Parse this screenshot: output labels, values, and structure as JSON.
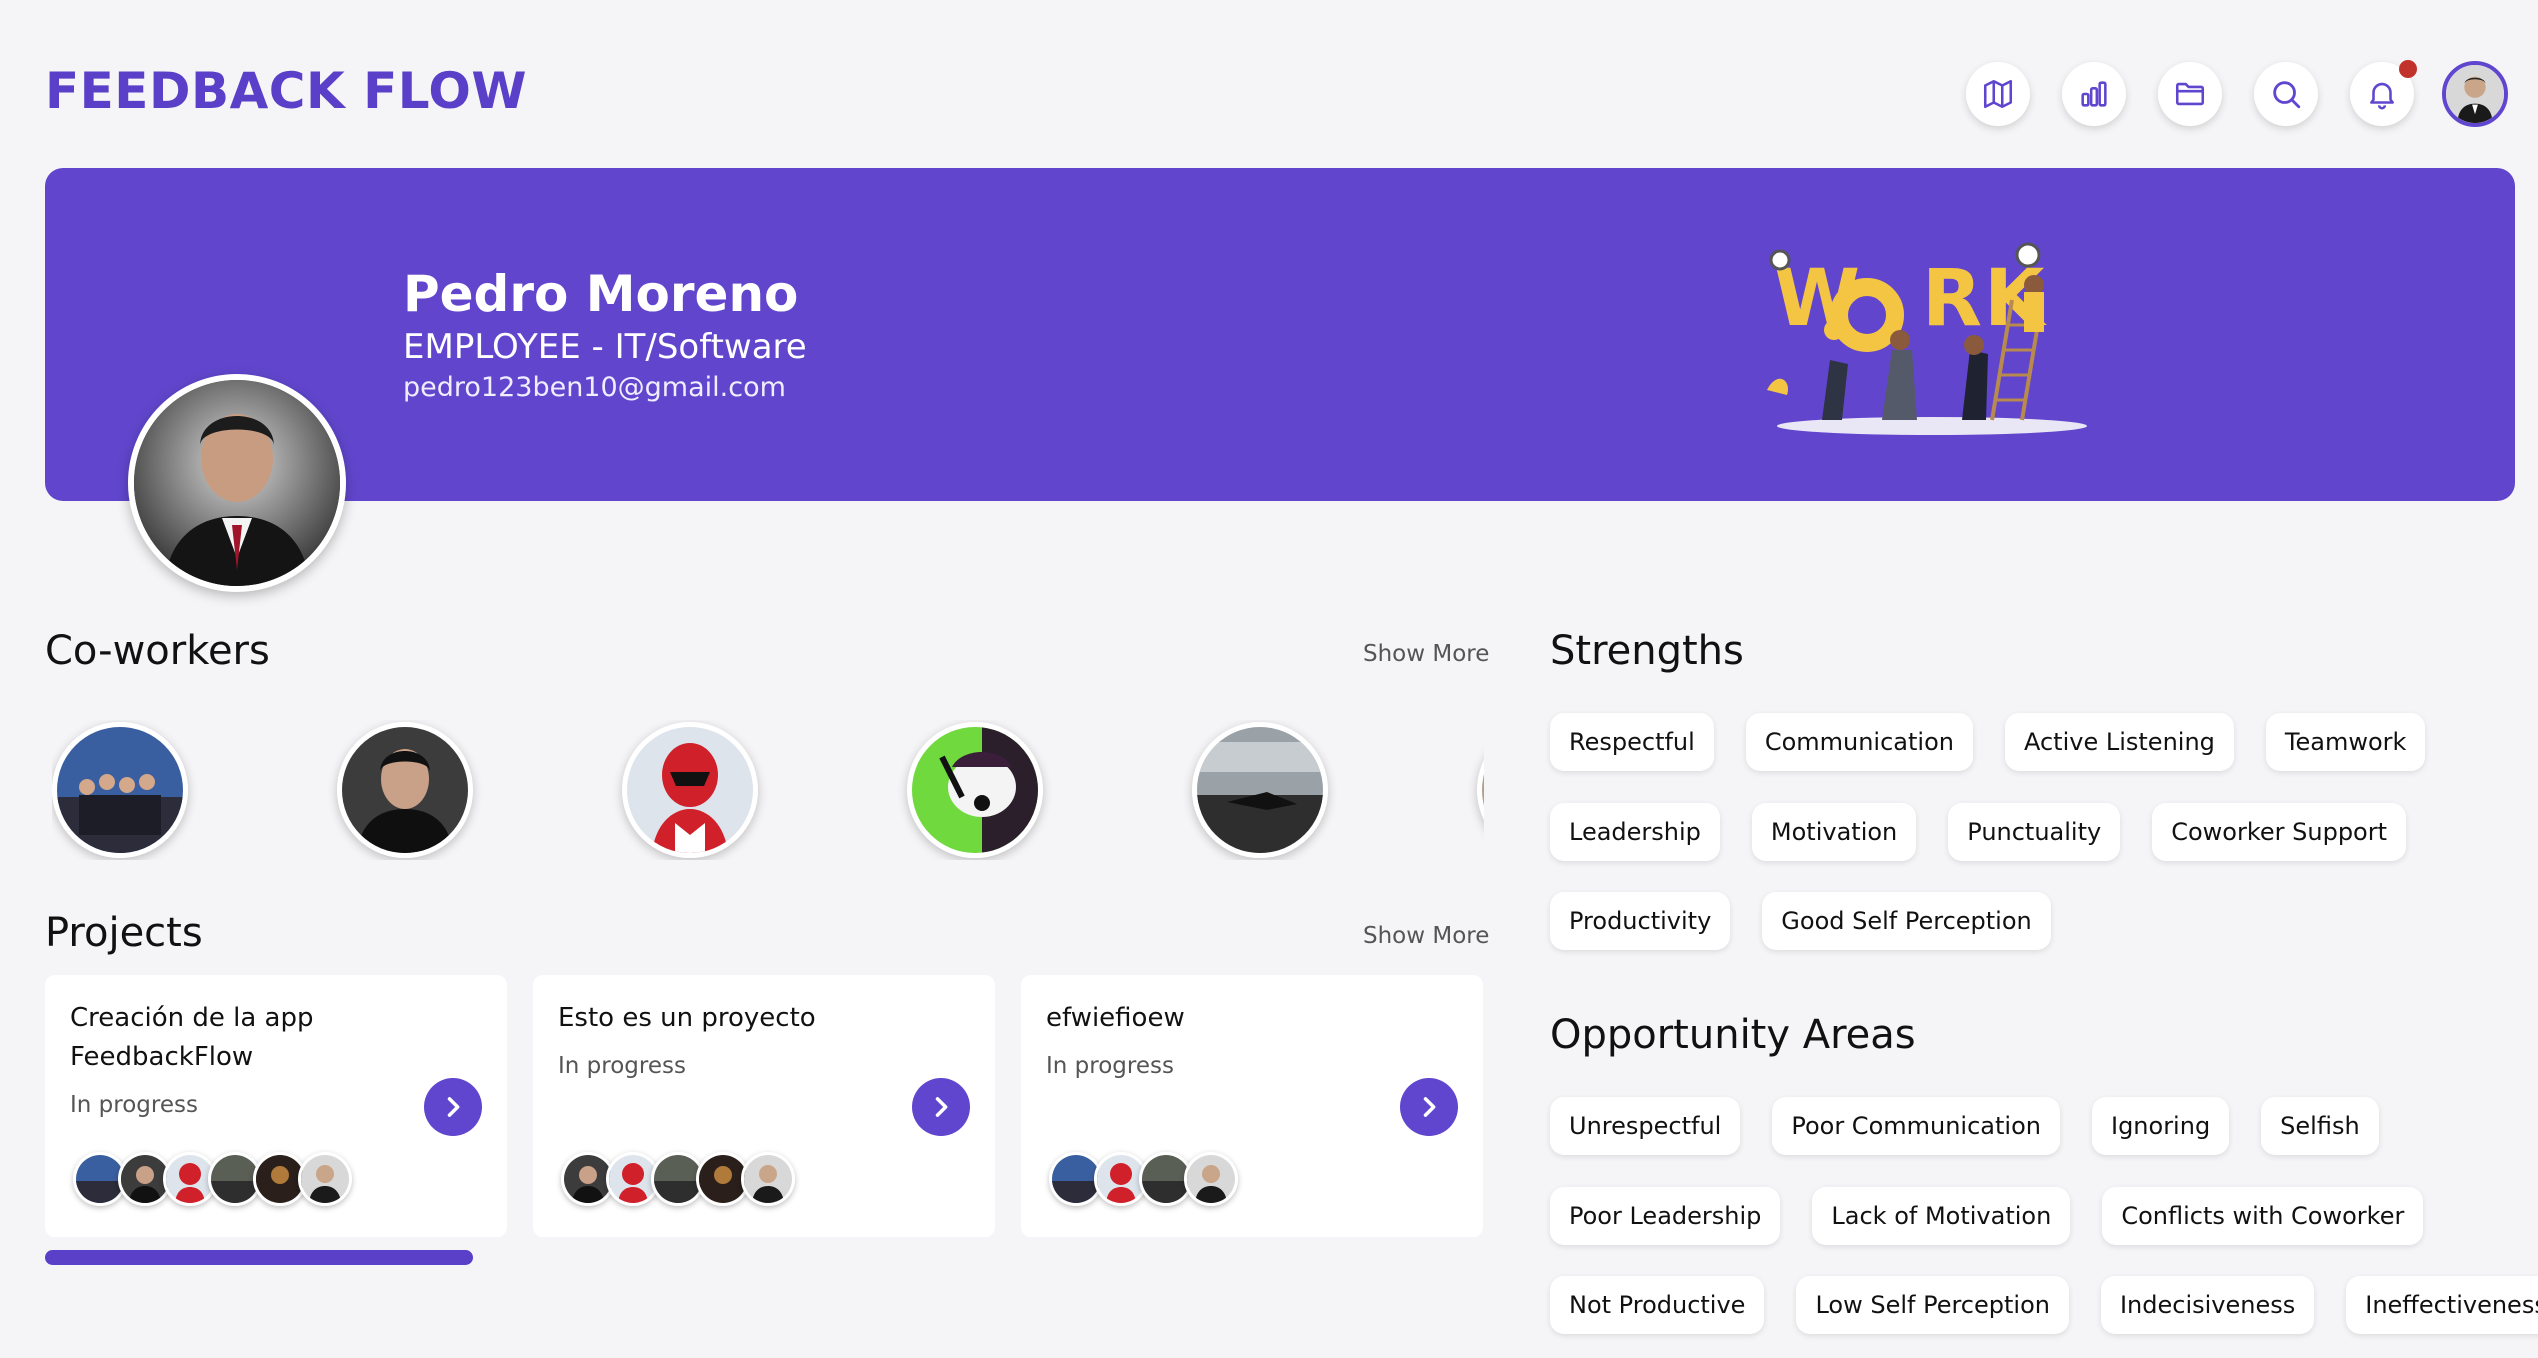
{
  "header": {
    "logo": "FEEDBACK FLOW",
    "icons": [
      "map-icon",
      "bar-chart-icon",
      "folder-icon",
      "search-icon",
      "bell-icon"
    ],
    "has_notification": true
  },
  "profile": {
    "name": "Pedro Moreno",
    "role": "EMPLOYEE",
    "separator": " - ",
    "department": "IT/Software",
    "email": "pedro123ben10@gmail.com"
  },
  "coworkers": {
    "title": "Co-workers",
    "show_more": "Show More",
    "count_visible": 6
  },
  "projects": {
    "title": "Projects",
    "show_more": "Show More",
    "items": [
      {
        "title": "Creación de la app FeedbackFlow",
        "status": "In progress",
        "members": 6
      },
      {
        "title": "Esto es un proyecto",
        "status": "In progress",
        "members": 5
      },
      {
        "title": "efwiefioew",
        "status": "In progress",
        "members": 4
      }
    ]
  },
  "strengths": {
    "title": "Strengths",
    "rows": [
      [
        "Respectful",
        "Communication",
        "Active Listening",
        "Teamwork"
      ],
      [
        "Leadership",
        "Motivation",
        "Punctuality",
        "Coworker Support"
      ],
      [
        "Productivity",
        "Good Self Perception"
      ]
    ]
  },
  "opportunities": {
    "title": "Opportunity Areas",
    "rows": [
      [
        "Unrespectful",
        "Poor Communication",
        "Ignoring",
        "Selfish"
      ],
      [
        "Poor Leadership",
        "Lack of Motivation",
        "Conflicts with Coworker"
      ],
      [
        "Not Productive",
        "Low Self Perception",
        "Indecisiveness",
        "Ineffectiveness"
      ]
    ]
  },
  "colors": {
    "accent": "#6046cf",
    "banner": "#6146cd",
    "background": "#f5f4f6",
    "notification": "#c0322b"
  }
}
